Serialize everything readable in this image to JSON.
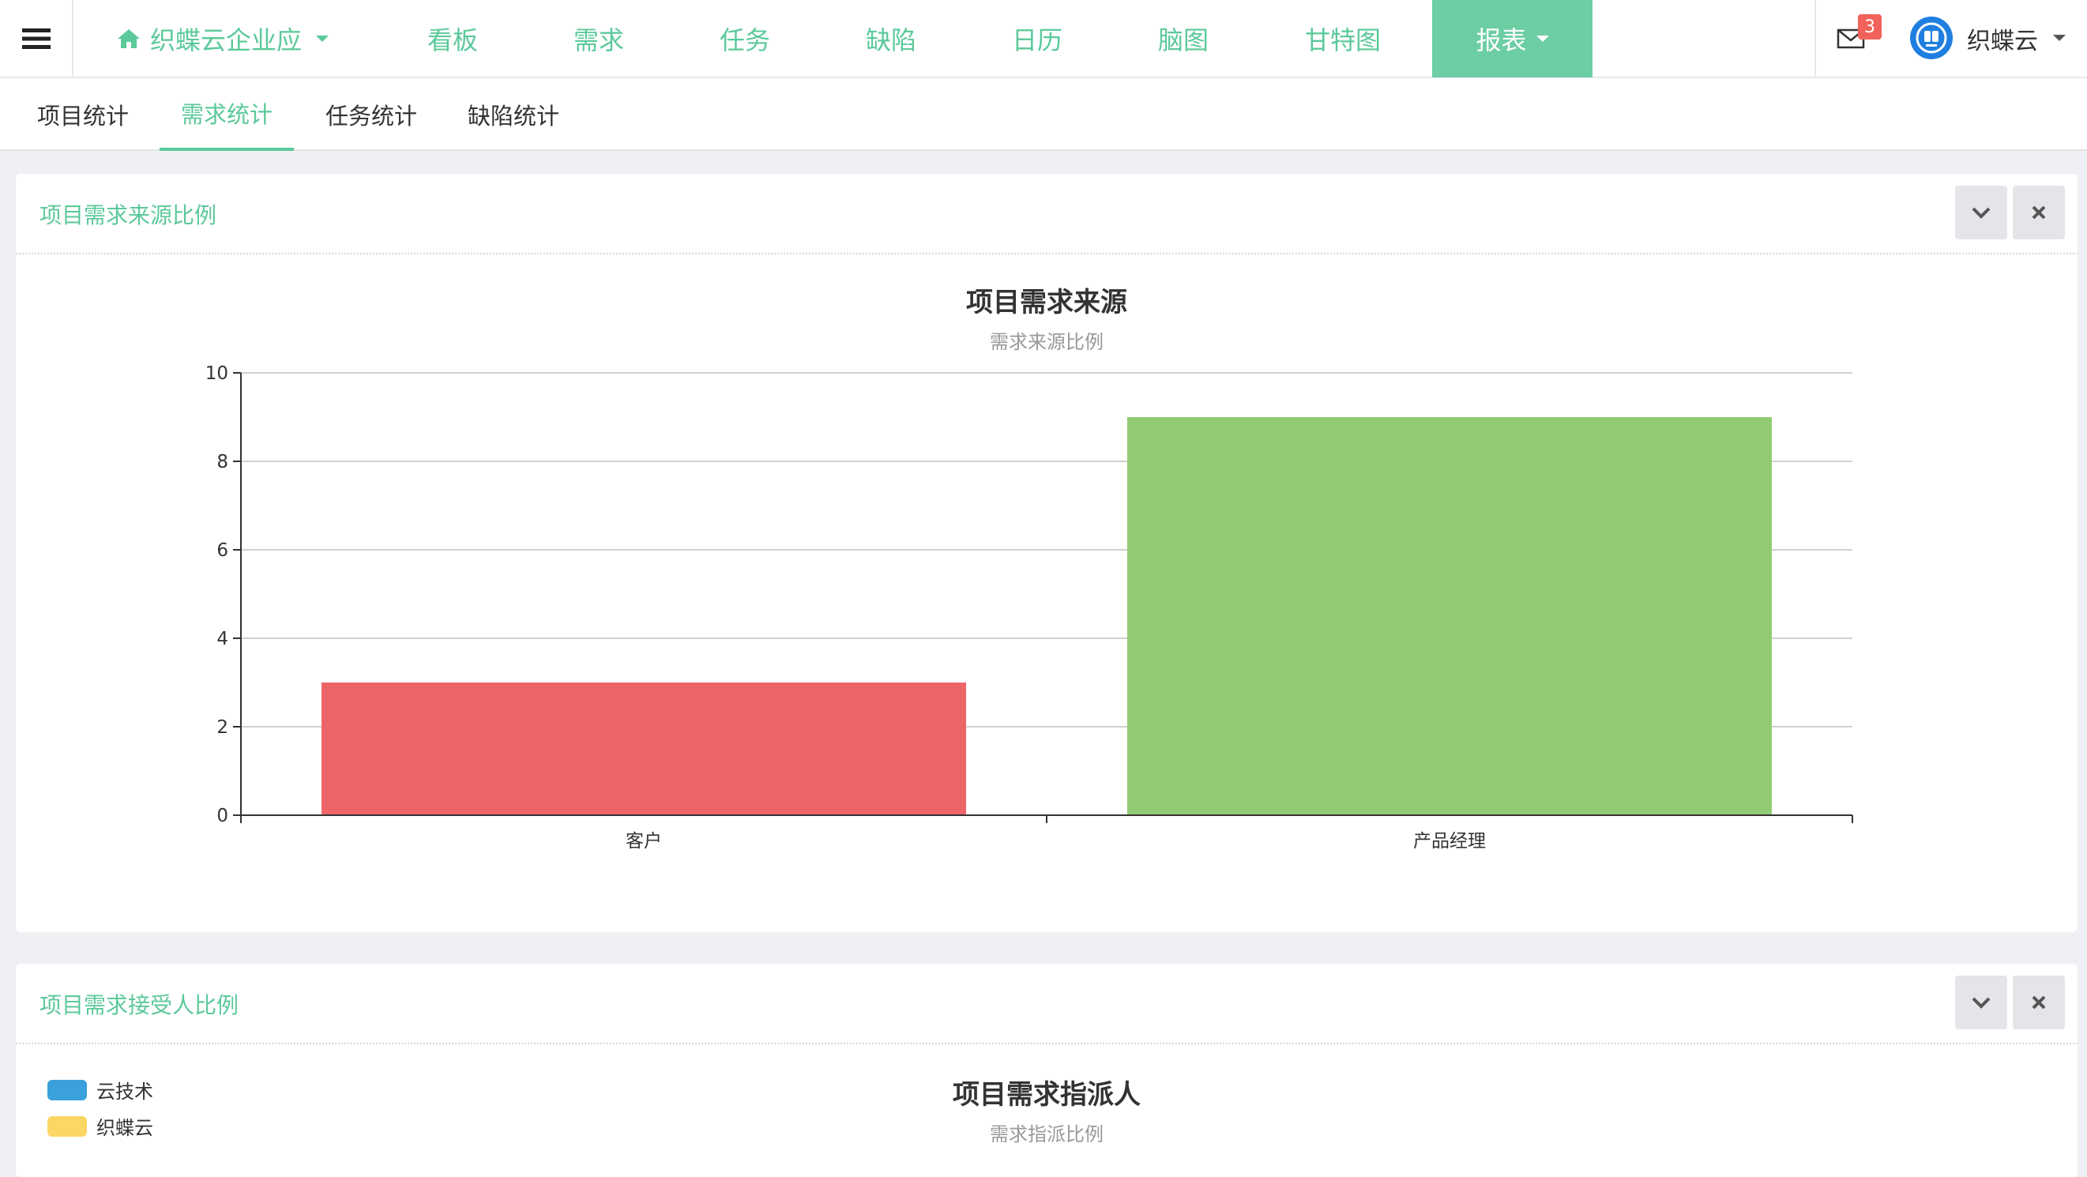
{
  "nav": {
    "project": "织蝶云企业应",
    "items": [
      "看板",
      "需求",
      "任务",
      "缺陷",
      "日历",
      "脑图",
      "甘特图"
    ],
    "active_item": "报表",
    "mail_count": "3",
    "user_name": "织蝶云",
    "accent": "#6dcea4"
  },
  "subtabs": {
    "items": [
      "项目统计",
      "需求统计",
      "任务统计",
      "缺陷统计"
    ],
    "active_index": 1
  },
  "panel1": {
    "title": "项目需求来源比例"
  },
  "panel2": {
    "title": "项目需求接受人比例",
    "chart_title": "项目需求指派人",
    "chart_subtitle": "需求指派比例",
    "legend": [
      {
        "label": "云技术",
        "color": "#3aa1dc"
      },
      {
        "label": "织蝶云",
        "color": "#fcd766"
      }
    ]
  },
  "chart_data": {
    "type": "bar",
    "title": "项目需求来源",
    "subtitle": "需求来源比例",
    "categories": [
      "客户",
      "产品经理"
    ],
    "values": [
      3,
      9
    ],
    "colors": [
      "#ee6567",
      "#91cc75"
    ],
    "ylim": [
      0,
      10
    ],
    "yticks": [
      "0",
      "2",
      "4",
      "6",
      "8",
      "10"
    ],
    "grid": true,
    "xlabel": "",
    "ylabel": ""
  }
}
